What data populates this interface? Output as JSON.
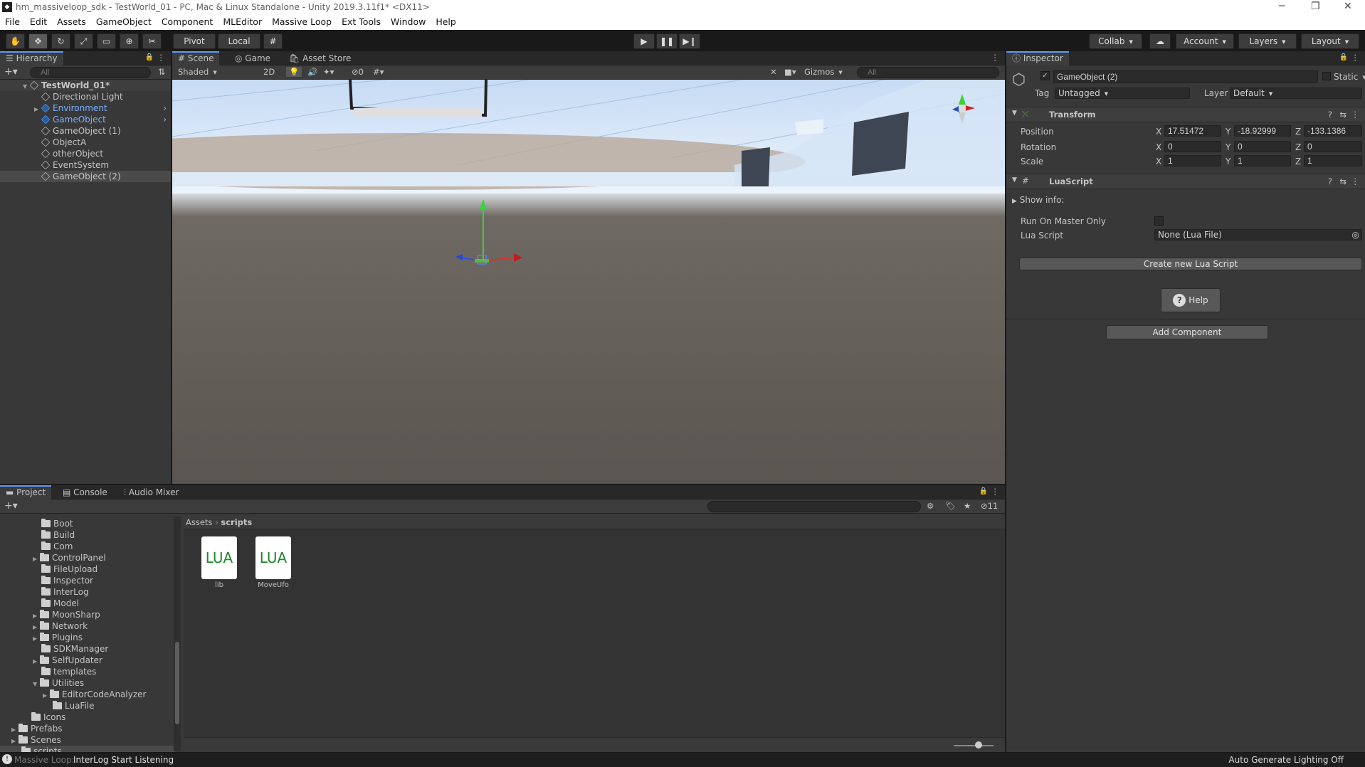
{
  "window": {
    "title": "hm_massiveloop_sdk - TestWorld_01 - PC, Mac & Linux Standalone - Unity 2019.3.11f1* <DX11>"
  },
  "menu": [
    "File",
    "Edit",
    "Assets",
    "GameObject",
    "Component",
    "MLEditor",
    "Massive Loop",
    "Ext Tools",
    "Window",
    "Help"
  ],
  "toolbar": {
    "pivot": "Pivot",
    "local": "Local",
    "collab": "Collab",
    "account": "Account",
    "layers": "Layers",
    "layout": "Layout"
  },
  "hierarchy": {
    "tab": "Hierarchy",
    "search_placeholder": "All",
    "scene": "TestWorld_01*",
    "items": [
      "Directional Light",
      "Environment",
      "GameObject",
      "GameObject (1)",
      "ObjectA",
      "otherObject",
      "EventSystem",
      "GameObject (2)"
    ]
  },
  "scene_view": {
    "tabs": [
      "Scene",
      "Game",
      "Asset Store"
    ],
    "shading": "Shaded",
    "mode_2d": "2D",
    "hidden_count": "0",
    "gizmos": "Gizmos",
    "search_placeholder": "All"
  },
  "inspector": {
    "tab": "Inspector",
    "object_name": "GameObject (2)",
    "static_label": "Static",
    "tag_label": "Tag",
    "tag_value": "Untagged",
    "layer_label": "Layer",
    "layer_value": "Default",
    "transform": {
      "title": "Transform",
      "position_label": "Position",
      "position": {
        "x": "17.51472",
        "y": "-18.92999",
        "z": "-133.1386"
      },
      "rotation_label": "Rotation",
      "rotation": {
        "x": "0",
        "y": "0",
        "z": "0"
      },
      "scale_label": "Scale",
      "scale": {
        "x": "1",
        "y": "1",
        "z": "1"
      },
      "axis_x": "X",
      "axis_y": "Y",
      "axis_z": "Z"
    },
    "lua": {
      "title": "LuaScript",
      "show_info": "Show info:",
      "run_master_label": "Run On Master Only",
      "script_label": "Lua Script",
      "script_value": "None (Lua File)",
      "create_button": "Create new Lua Script",
      "help_button": "Help"
    },
    "add_component": "Add Component"
  },
  "project": {
    "tabs": [
      "Project",
      "Console",
      "Audio Mixer"
    ],
    "hidden_count": "11",
    "breadcrumb": {
      "root": "Assets",
      "current": "scripts"
    },
    "folders": [
      "Boot",
      "Build",
      "Com",
      "ControlPanel",
      "FileUpload",
      "Inspector",
      "InterLog",
      "Model",
      "MoonSharp",
      "Network",
      "Plugins",
      "SDKManager",
      "SelfUpdater",
      "templates",
      "Utilities",
      "EditorCodeAnalyzer",
      "LuaFile",
      "Icons",
      "Prefabs",
      "Scenes",
      "scripts"
    ],
    "files": [
      {
        "icon": "LUA",
        "name": "lib"
      },
      {
        "icon": "LUA",
        "name": "MoveUfo"
      }
    ]
  },
  "status": {
    "prefix": "Massive Loop:",
    "message": "InterLog Start Listening",
    "right": "Auto Generate Lighting Off"
  }
}
